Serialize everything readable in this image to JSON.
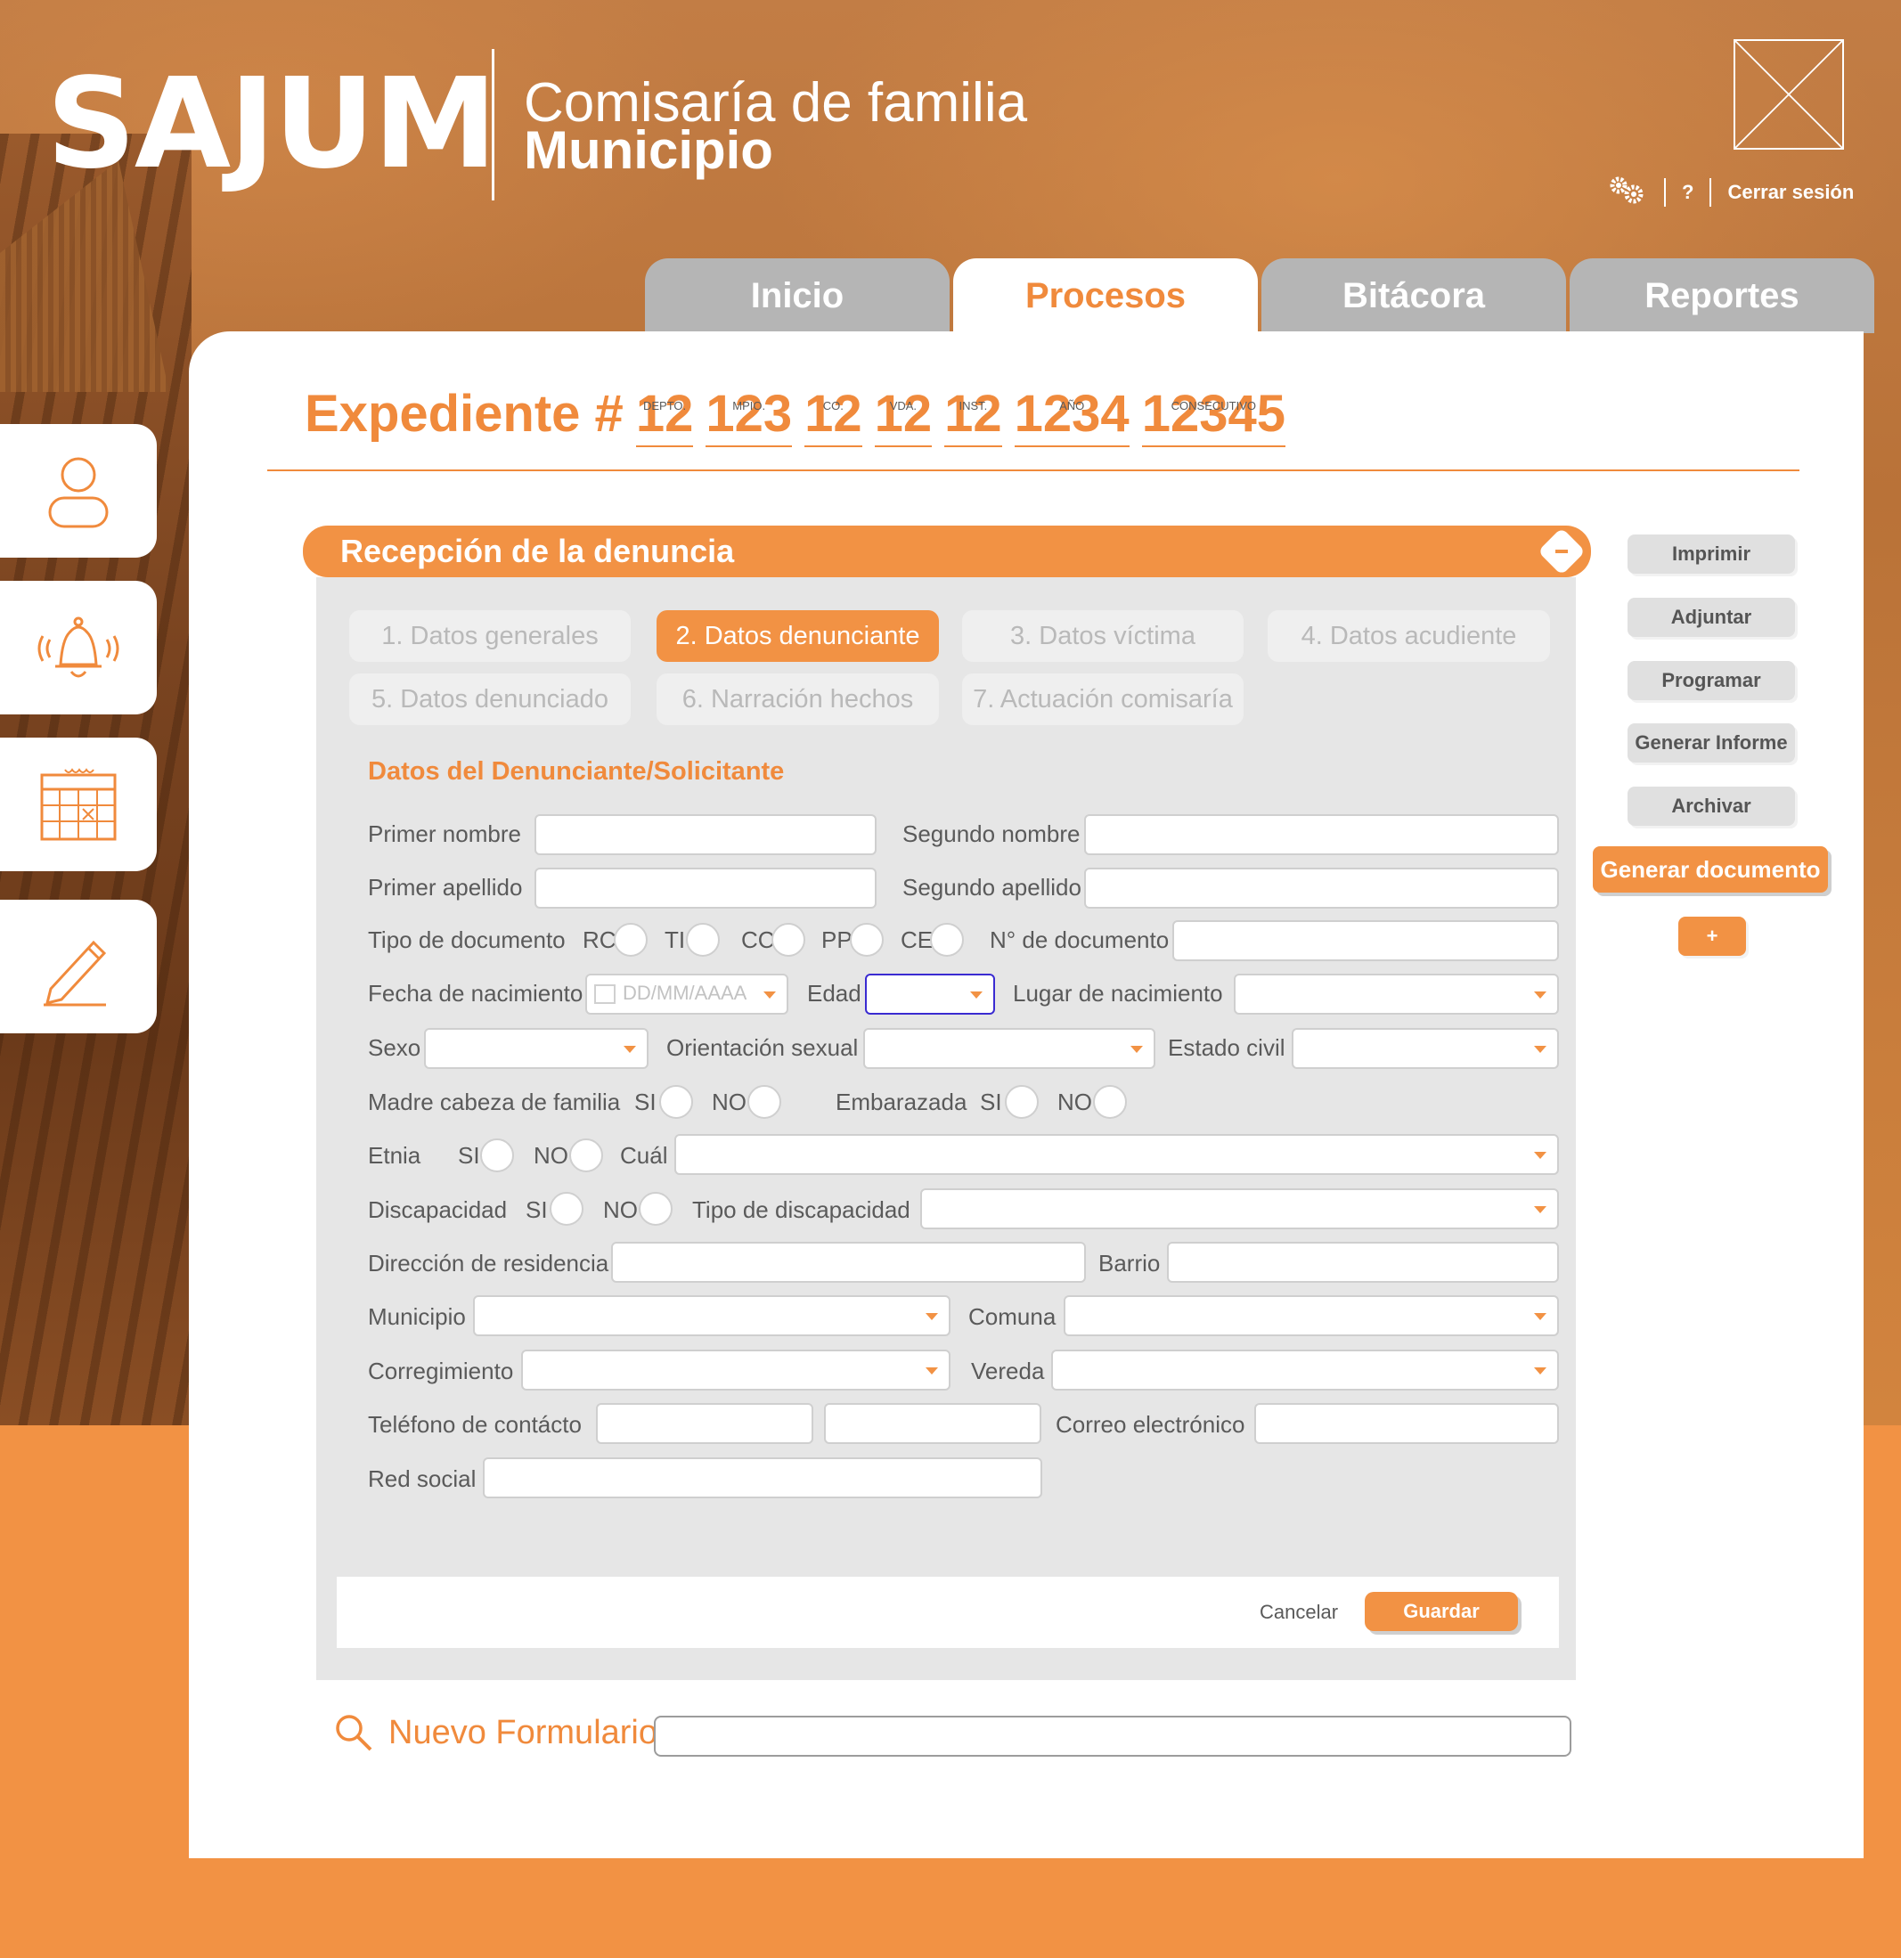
{
  "brand": {
    "logo": "SAJUM",
    "title_line1": "Comisaría de familia",
    "title_line2": "Municipio"
  },
  "top_tools": {
    "settings_icon": "gears-icon",
    "help_label": "?",
    "logout_label": "Cerrar sesión"
  },
  "tabs": [
    {
      "label": "Inicio"
    },
    {
      "label": "Procesos",
      "active": true
    },
    {
      "label": "Bitácora"
    },
    {
      "label": "Reportes"
    }
  ],
  "side_icons": [
    "user-icon",
    "bell-icon",
    "calendar-icon",
    "pencil-icon"
  ],
  "expediente": {
    "label": "Expediente #",
    "parts": [
      {
        "value": "12",
        "caption": "DEPTO."
      },
      {
        "value": "123",
        "caption": "MPIO."
      },
      {
        "value": "12",
        "caption": "CO."
      },
      {
        "value": "12",
        "caption": "VDA."
      },
      {
        "value": "12",
        "caption": "INST."
      },
      {
        "value": "1234",
        "caption": "AÑO"
      },
      {
        "value": "12345",
        "caption": "CONSECUTIVO"
      }
    ]
  },
  "section": {
    "title": "Recepción de la denuncia"
  },
  "steps": [
    "1. Datos generales",
    "2. Datos denunciante",
    "3. Datos víctima",
    "4. Datos acudiente",
    "5. Datos denunciado",
    "6. Narración hechos",
    "7. Actuación comisaría"
  ],
  "active_step": "2. Datos denunciante",
  "form": {
    "title": "Datos del Denunciante/Solicitante",
    "labels": {
      "primer_nombre": "Primer nombre",
      "segundo_nombre": "Segundo nombre",
      "primer_apellido": "Primer apellido",
      "segundo_apellido": "Segundo apellido",
      "tipo_documento": "Tipo de documento",
      "rc": "RC",
      "ti": "TI",
      "cc": "CC",
      "pp": "PP",
      "ce": "CE",
      "num_documento": "N° de documento",
      "fecha_nacimiento": "Fecha de nacimiento",
      "edad": "Edad",
      "lugar_nacimiento": "Lugar de nacimiento",
      "sexo": "Sexo",
      "orientacion": "Orientación sexual",
      "estado_civil": "Estado civil",
      "madre_cabeza": "Madre cabeza de familia",
      "si": "SI",
      "no": "NO",
      "embarazada": "Embarazada",
      "etnia": "Etnia",
      "cual": "Cuál",
      "discapacidad": "Discapacidad",
      "tipo_discapacidad": "Tipo de discapacidad",
      "direccion": "Dirección de residencia",
      "barrio": "Barrio",
      "municipio": "Municipio",
      "comuna": "Comuna",
      "corregimiento": "Corregimiento",
      "vereda": "Vereda",
      "telefono": "Teléfono de contácto",
      "correo": "Correo electrónico",
      "red_social": "Red social"
    },
    "date_placeholder": "DD/MM/AAAA"
  },
  "footer": {
    "cancel_label": "Cancelar",
    "save_label": "Guardar"
  },
  "new_form": {
    "label": "Nuevo Formulario"
  },
  "actions": {
    "imprimir": "Imprimir",
    "adjuntar": "Adjuntar",
    "programar": "Programar",
    "generar_informe": "Generar Informe",
    "archivar": "Archivar",
    "generar_documento": "Generar documento",
    "plus": "+"
  },
  "colors": {
    "accent": "#f29244",
    "accent_text": "#f08a3c",
    "tab_inactive": "#b5b5b5",
    "form_bg": "#e6e6e6"
  }
}
